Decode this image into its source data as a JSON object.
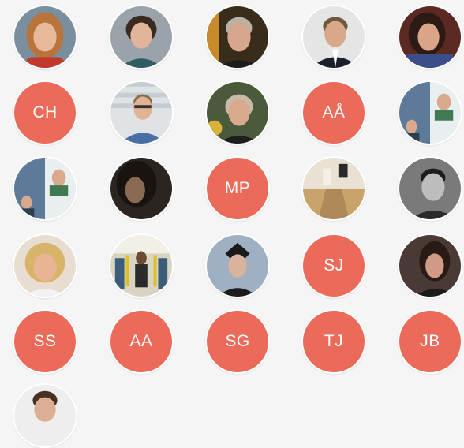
{
  "colors": {
    "initials_bg": "#ec6a59",
    "page_bg": "#f5f5f5"
  },
  "members": [
    {
      "kind": "photo",
      "label": "member-photo-1"
    },
    {
      "kind": "photo",
      "label": "member-photo-2"
    },
    {
      "kind": "photo",
      "label": "member-photo-3"
    },
    {
      "kind": "photo",
      "label": "member-photo-4"
    },
    {
      "kind": "photo",
      "label": "member-photo-5"
    },
    {
      "kind": "initials",
      "initials": "CH"
    },
    {
      "kind": "photo",
      "label": "member-photo-6"
    },
    {
      "kind": "photo",
      "label": "member-photo-7"
    },
    {
      "kind": "initials",
      "initials": "AÅ"
    },
    {
      "kind": "photo",
      "label": "member-photo-8"
    },
    {
      "kind": "photo",
      "label": "member-photo-9"
    },
    {
      "kind": "photo",
      "label": "member-photo-10"
    },
    {
      "kind": "initials",
      "initials": "MP"
    },
    {
      "kind": "photo",
      "label": "member-photo-11"
    },
    {
      "kind": "photo",
      "label": "member-photo-12"
    },
    {
      "kind": "photo",
      "label": "member-photo-13"
    },
    {
      "kind": "photo",
      "label": "member-photo-14"
    },
    {
      "kind": "photo",
      "label": "member-photo-15"
    },
    {
      "kind": "initials",
      "initials": "SJ"
    },
    {
      "kind": "photo",
      "label": "member-photo-16"
    },
    {
      "kind": "initials",
      "initials": "SS"
    },
    {
      "kind": "initials",
      "initials": "AA"
    },
    {
      "kind": "initials",
      "initials": "SG"
    },
    {
      "kind": "initials",
      "initials": "TJ"
    },
    {
      "kind": "initials",
      "initials": "JB"
    },
    {
      "kind": "photo",
      "label": "member-photo-17"
    }
  ]
}
